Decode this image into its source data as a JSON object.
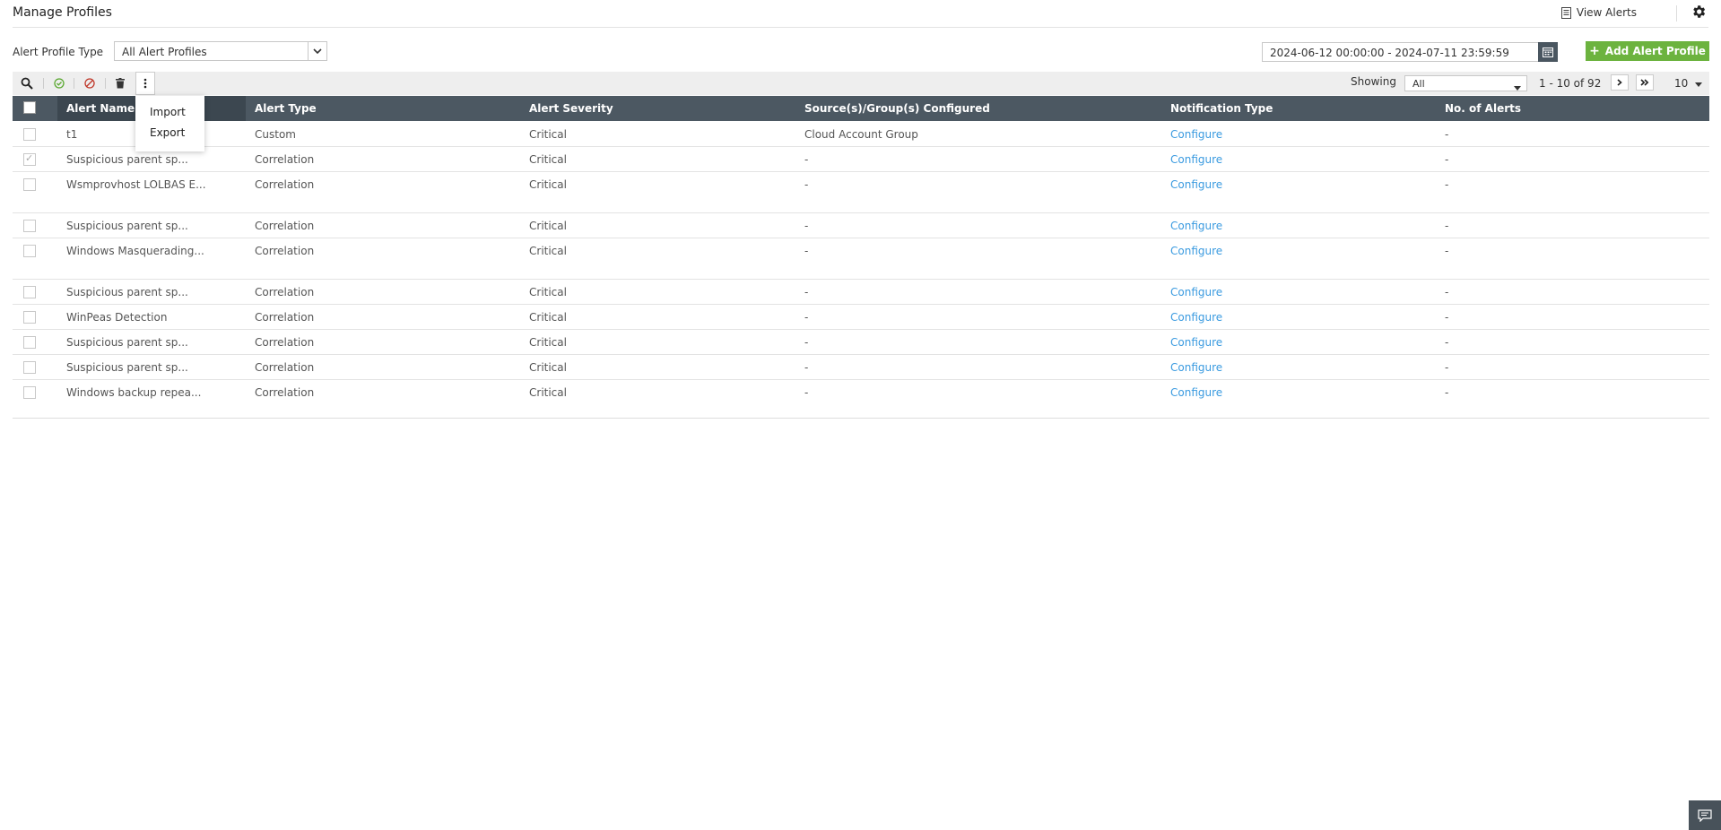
{
  "header": {
    "title": "Manage Profiles",
    "view_alerts": "View Alerts"
  },
  "filter": {
    "label": "Alert Profile Type",
    "value": "All Alert Profiles"
  },
  "date_range": "2024-06-12 00:00:00 - 2024-07-11 23:59:59",
  "add_button": "Add Alert Profile",
  "pager": {
    "showing_label": "Showing",
    "showing_value": "All",
    "range": "1 - 10 of 92",
    "per_page": "10"
  },
  "menu": {
    "import": "Import",
    "export": "Export"
  },
  "columns": {
    "name": "Alert Name",
    "type": "Alert Type",
    "severity": "Alert Severity",
    "sources": "Source(s)/Group(s) Configured",
    "notification": "Notification Type",
    "count": "No. of Alerts"
  },
  "rows": [
    {
      "name": "t1",
      "type": "Custom",
      "severity": "Critical",
      "sources": "Cloud Account Group",
      "notification": "Configure",
      "count": "-"
    },
    {
      "name": "Suspicious parent sp...",
      "type": "Correlation",
      "severity": "Critical",
      "sources": "-",
      "notification": "Configure",
      "count": "-"
    },
    {
      "name": "Wsmprovhost LOLBAS E...",
      "type": "Correlation",
      "severity": "Critical",
      "sources": "-",
      "notification": "Configure",
      "count": "-"
    },
    {
      "name": "Suspicious parent sp...",
      "type": "Correlation",
      "severity": "Critical",
      "sources": "-",
      "notification": "Configure",
      "count": "-"
    },
    {
      "name": "Windows Masquerading...",
      "type": "Correlation",
      "severity": "Critical",
      "sources": "-",
      "notification": "Configure",
      "count": "-"
    },
    {
      "name": "Suspicious parent sp...",
      "type": "Correlation",
      "severity": "Critical",
      "sources": "-",
      "notification": "Configure",
      "count": "-"
    },
    {
      "name": "WinPeas Detection",
      "type": "Correlation",
      "severity": "Critical",
      "sources": "-",
      "notification": "Configure",
      "count": "-"
    },
    {
      "name": "Suspicious parent sp...",
      "type": "Correlation",
      "severity": "Critical",
      "sources": "-",
      "notification": "Configure",
      "count": "-"
    },
    {
      "name": "Suspicious parent sp...",
      "type": "Correlation",
      "severity": "Critical",
      "sources": "-",
      "notification": "Configure",
      "count": "-"
    },
    {
      "name": "Windows backup repea...",
      "type": "Correlation",
      "severity": "Critical",
      "sources": "-",
      "notification": "Configure",
      "count": "-"
    }
  ],
  "colors": {
    "accent_green": "#6cb33f",
    "header_dark": "#4c5862",
    "link_blue": "#3b9be0"
  }
}
